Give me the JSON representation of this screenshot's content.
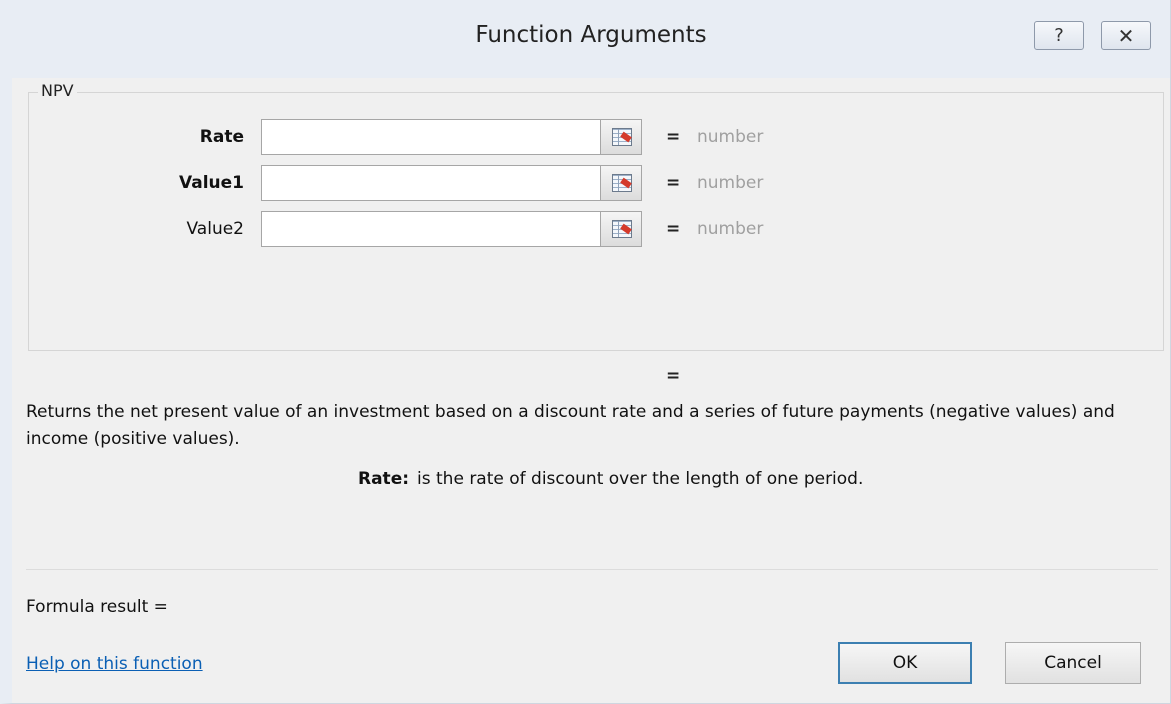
{
  "window": {
    "title": "Function Arguments",
    "help_button": "?",
    "close_button": "✕"
  },
  "function_name": "NPV",
  "arguments": [
    {
      "label": "Rate",
      "value": "",
      "equals": "=",
      "hint": "number",
      "bold": true
    },
    {
      "label": "Value1",
      "value": "",
      "equals": "=",
      "hint": "number",
      "bold": true
    },
    {
      "label": "Value2",
      "value": "",
      "equals": "=",
      "hint": "number",
      "bold": false
    }
  ],
  "result_equals": "=",
  "description": "Returns the net present value of an investment based on a discount rate and a series of future payments (negative values) and income (positive values).",
  "current_arg": {
    "name": "Rate:",
    "text": "is the rate of discount over the length of one period."
  },
  "formula_result": "Formula result =",
  "help_link": "Help on this function",
  "buttons": {
    "ok": "OK",
    "cancel": "Cancel"
  }
}
